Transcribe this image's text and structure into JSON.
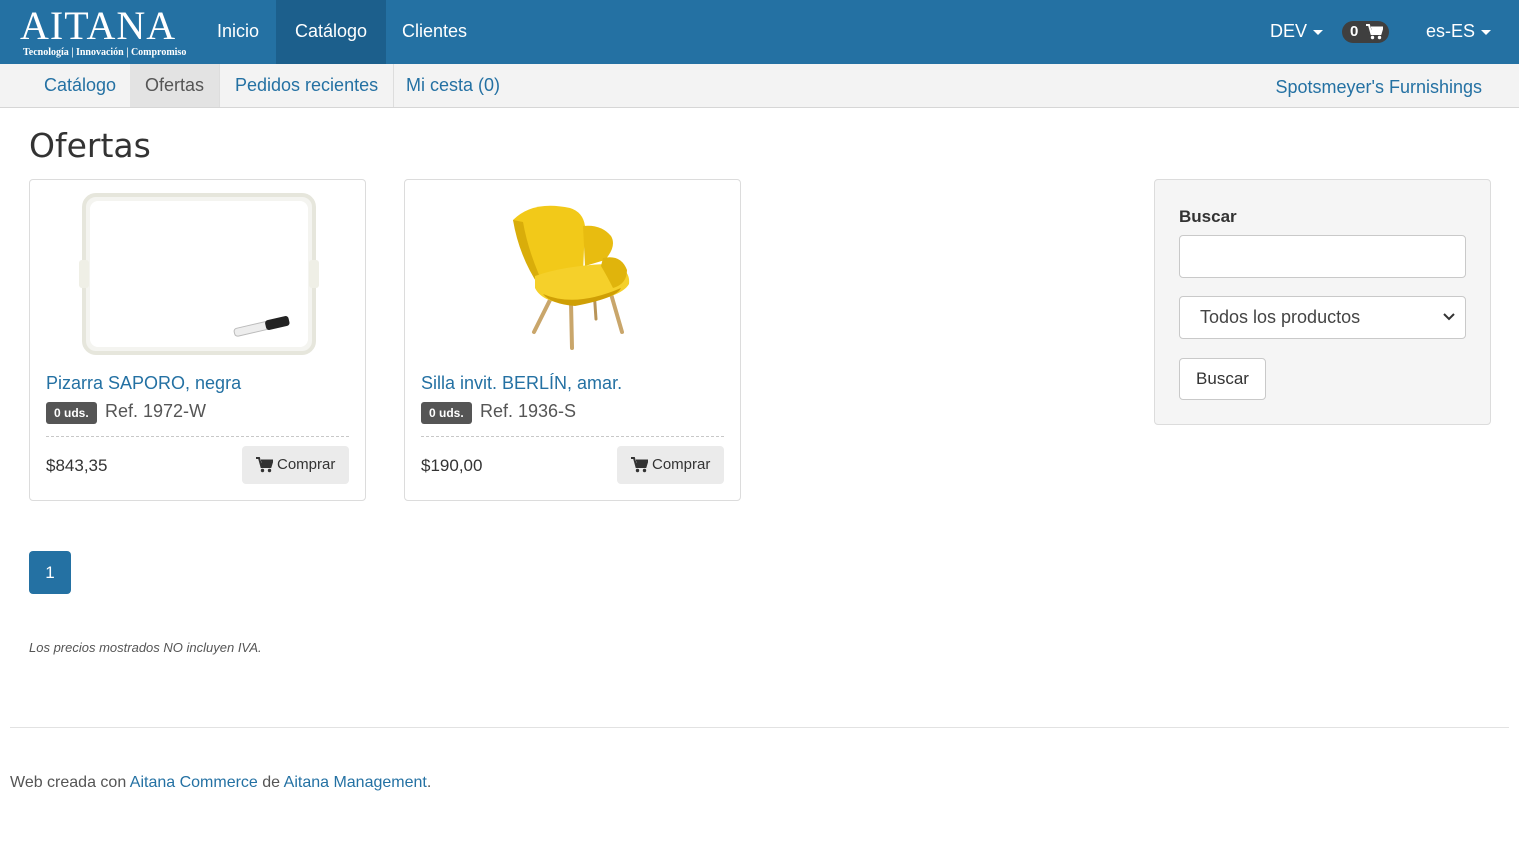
{
  "brand": {
    "logo_text": "AITANA",
    "tagline": "Tecnología | Innovación | Compromiso"
  },
  "navbar": {
    "items": [
      {
        "label": "Inicio",
        "active": false
      },
      {
        "label": "Catálogo",
        "active": true
      },
      {
        "label": "Clientes",
        "active": false
      }
    ],
    "env_label": "DEV",
    "cart_count": "0",
    "locale_label": "es-ES"
  },
  "subnav": {
    "items": [
      {
        "label": "Catálogo",
        "active": false
      },
      {
        "label": "Ofertas",
        "active": true
      },
      {
        "label": "Pedidos recientes",
        "active": false
      },
      {
        "label": "Mi cesta (0)",
        "active": false
      }
    ],
    "store_name": "Spotsmeyer's Furnishings"
  },
  "page_title": "Ofertas",
  "products": [
    {
      "name": "Pizarra SAPORO, negra",
      "stock_badge": "0 uds.",
      "ref": "Ref. 1972-W",
      "price": "$843,35",
      "buy_label": "Comprar",
      "image_icon": "whiteboard-image"
    },
    {
      "name": "Silla invit. BERLÍN, amar.",
      "stock_badge": "0 uds.",
      "ref": "Ref. 1936-S",
      "price": "$190,00",
      "buy_label": "Comprar",
      "image_icon": "yellow-armchair-image"
    }
  ],
  "search": {
    "label": "Buscar",
    "input_value": "",
    "category_selected": "Todos los productos",
    "button_label": "Buscar"
  },
  "pagination": {
    "current_page": "1"
  },
  "tax_note": "Los precios mostrados NO incluyen IVA.",
  "footer": {
    "prefix": "Web creada con ",
    "link1": "Aitana Commerce",
    "middle": " de ",
    "link2": "Aitana Management",
    "suffix": "."
  },
  "colors": {
    "primary": "#2471a3",
    "navbar_active": "#1c5f8c",
    "badge": "#555555",
    "chair_yellow": "#f2c919"
  }
}
